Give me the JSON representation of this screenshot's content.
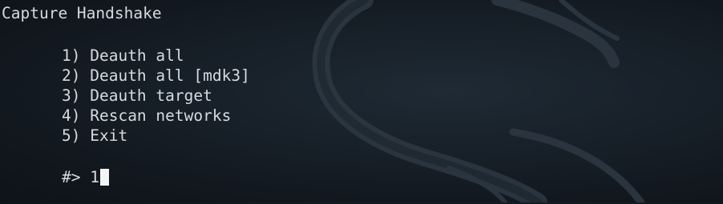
{
  "terminal": {
    "title": "Capture Handshake",
    "menu": [
      {
        "num": "1)",
        "label": "Deauth all"
      },
      {
        "num": "2)",
        "label": "Deauth all [mdk3]"
      },
      {
        "num": "3)",
        "label": "Deauth target"
      },
      {
        "num": "4)",
        "label": "Rescan networks"
      },
      {
        "num": "5)",
        "label": "Exit"
      }
    ],
    "prompt": "#>",
    "input_value": "1"
  },
  "colors": {
    "background": "#151c23",
    "text": "#d6dbe0",
    "cursor": "#f2f4f6"
  },
  "icons": {
    "background": "dragon-logo-watermark"
  }
}
